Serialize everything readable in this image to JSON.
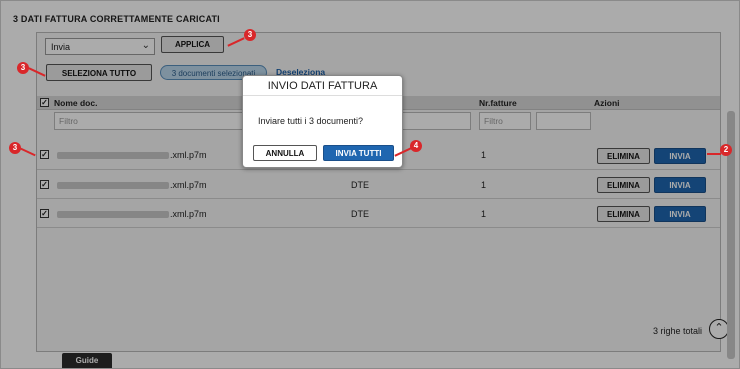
{
  "page": {
    "title": "3 DATI FATTURA CORRETTAMENTE CARICATI"
  },
  "toolbar": {
    "select_value": "Invia",
    "apply_label": "APPLICA",
    "select_all_label": "SELEZIONA TUTTO",
    "selected_count_label": "3 documenti selezionati",
    "deselect_label": "Deseleziona"
  },
  "table": {
    "headers": {
      "name": "Nome doc.",
      "count": "Nr.fatture",
      "actions": "Azioni"
    },
    "filter_placeholder": "Filtro",
    "rows": [
      {
        "name_suffix": ".xml.p7m",
        "type": "",
        "count": "1",
        "delete_label": "ELIMINA",
        "send_label": "INVIA"
      },
      {
        "name_suffix": ".xml.p7m",
        "type": "DTE",
        "count": "1",
        "delete_label": "ELIMINA",
        "send_label": "INVIA"
      },
      {
        "name_suffix": ".xml.p7m",
        "type": "DTE",
        "count": "1",
        "delete_label": "ELIMINA",
        "send_label": "INVIA"
      }
    ],
    "total": "3 righe totali"
  },
  "dialog": {
    "title": "INVIO DATI FATTURA",
    "message": "Inviare tutti i 3 documenti?",
    "cancel_label": "ANNULLA",
    "confirm_label": "INVIA TUTTI"
  },
  "footer": {
    "guide_label": "Guide"
  },
  "markers": {
    "m1": "3",
    "m2": "3",
    "m3": "3",
    "m4": "4",
    "m5": "2"
  },
  "colors": {
    "accent": "#1f66b0",
    "marker": "#d9272a",
    "pill": "#bcd9ee"
  }
}
